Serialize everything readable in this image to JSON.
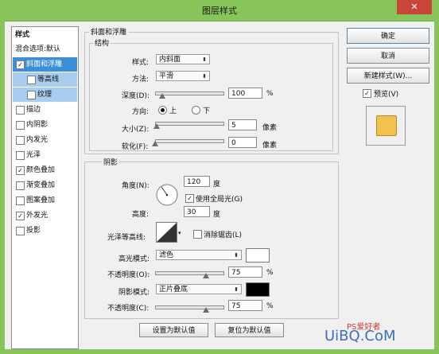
{
  "window": {
    "title": "图层样式",
    "close_glyph": "✕"
  },
  "style_list": {
    "header": "样式",
    "blend_options": "混合选项:默认",
    "items": [
      {
        "label": "斜面和浮雕",
        "checked": true
      },
      {
        "label": "等高线",
        "checked": false
      },
      {
        "label": "纹理",
        "checked": false
      },
      {
        "label": "描边",
        "checked": false
      },
      {
        "label": "内阴影",
        "checked": false
      },
      {
        "label": "内发光",
        "checked": false
      },
      {
        "label": "光泽",
        "checked": false
      },
      {
        "label": "颜色叠加",
        "checked": true
      },
      {
        "label": "渐变叠加",
        "checked": false
      },
      {
        "label": "图案叠加",
        "checked": false
      },
      {
        "label": "外发光",
        "checked": true
      },
      {
        "label": "投影",
        "checked": false
      }
    ]
  },
  "bevel": {
    "group_title": "斜面和浮雕",
    "structure_title": "结构",
    "style_label": "样式:",
    "style_value": "内斜面",
    "technique_label": "方法:",
    "technique_value": "平滑",
    "depth_label": "深度(D):",
    "depth_value": "100",
    "depth_unit": "%",
    "depth_slider": 0.1,
    "direction_label": "方向:",
    "direction_up": "上",
    "direction_down": "下",
    "direction_selected": "上",
    "size_label": "大小(Z):",
    "size_value": "5",
    "size_unit": "像素",
    "size_slider": 0.02,
    "soften_label": "软化(F):",
    "soften_value": "0",
    "soften_unit": "像素",
    "soften_slider": 0.0
  },
  "shading": {
    "group_title": "阴影",
    "angle_label": "角度(N):",
    "angle_value": "120",
    "angle_unit": "度",
    "global_light_label": "使用全局光(G)",
    "global_light_checked": true,
    "altitude_label": "高度:",
    "altitude_value": "30",
    "altitude_unit": "度",
    "gloss_label": "光泽等高线:",
    "anti_alias_label": "消除锯齿(L)",
    "anti_alias_checked": false,
    "highlight_mode_label": "高光模式:",
    "highlight_mode_value": "滤色",
    "highlight_color": "#ffffff",
    "highlight_opacity_label": "不透明度(O):",
    "highlight_opacity_value": "75",
    "highlight_opacity_unit": "%",
    "highlight_opacity_slider": 0.75,
    "shadow_mode_label": "阴影模式:",
    "shadow_mode_value": "正片叠底",
    "shadow_color": "#000000",
    "shadow_opacity_label": "不透明度(C):",
    "shadow_opacity_value": "75",
    "shadow_opacity_unit": "%",
    "shadow_opacity_slider": 0.75
  },
  "footer": {
    "make_default": "设置为默认值",
    "reset_default": "复位为默认值"
  },
  "right_panel": {
    "ok": "确定",
    "cancel": "取消",
    "new_style": "新建样式(W)...",
    "preview_label": "预览(V)",
    "preview_checked": true,
    "preview_color": "#f2c14e"
  },
  "watermark": {
    "text": "UiBQ.CoM",
    "brand": "PS爱好者"
  },
  "colors": {
    "titlebar": "#87c45a",
    "selection": "#3b8fd6",
    "close": "#c9453b"
  }
}
